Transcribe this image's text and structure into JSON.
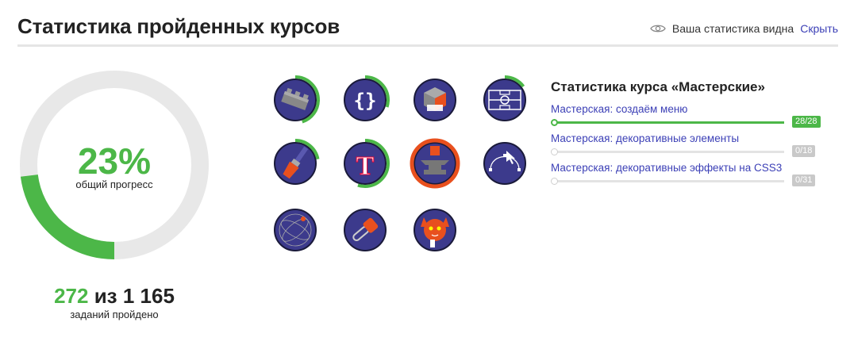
{
  "header": {
    "title": "Статистика пройденных курсов",
    "visibility_text": "Ваша статистика видна",
    "hide_link": "Скрыть",
    "eye_icon": "eye-icon"
  },
  "progress": {
    "percent_text": "23%",
    "percent_value": 23,
    "percent_label": "общий прогресс",
    "done": "272",
    "between": "из",
    "total": "1 165",
    "done_label": "заданий пройдено",
    "colors": {
      "track": "#e8e8e8",
      "fill": "#4cb748"
    }
  },
  "badges": [
    {
      "name": "lego-bricks",
      "icon": "lego-brick-icon",
      "progress": 0.45
    },
    {
      "name": "curly-braces",
      "icon": "curly-braces-icon",
      "progress": 0.3
    },
    {
      "name": "rubiks-cube",
      "icon": "rubiks-cube-icon",
      "progress": 0
    },
    {
      "name": "football-field",
      "icon": "football-field-icon",
      "progress": 0.15
    },
    {
      "name": "paint-brush",
      "icon": "paint-brush-icon",
      "progress": 0.22
    },
    {
      "name": "typography",
      "icon": "letter-t-icon",
      "progress": 0.55
    },
    {
      "name": "anvil-workshop",
      "icon": "anvil-icon",
      "progress": 1.0,
      "active": true
    },
    {
      "name": "bezier-curve",
      "icon": "bezier-cursor-icon",
      "progress": 0
    },
    {
      "name": "orbit-sphere",
      "icon": "orbit-icon",
      "progress": 0
    },
    {
      "name": "chainsaw",
      "icon": "chainsaw-icon",
      "progress": 0
    },
    {
      "name": "cat-mascot",
      "icon": "cat-icon",
      "progress": 0
    }
  ],
  "course": {
    "title": "Статистика курса «Мастерские»",
    "items": [
      {
        "label": "Мастерская: создаём меню",
        "count": "28/28",
        "progress": 1.0
      },
      {
        "label": "Мастерская: декоративные элементы",
        "count": "0/18",
        "progress": 0
      },
      {
        "label": "Мастерская: декоративные эффекты на CSS3",
        "count": "0/31",
        "progress": 0
      }
    ]
  },
  "colors": {
    "accent_green": "#4cb748",
    "link_blue": "#3b3fb6",
    "badge_navy": "#3c3a8c",
    "badge_orange": "#e8501e"
  }
}
